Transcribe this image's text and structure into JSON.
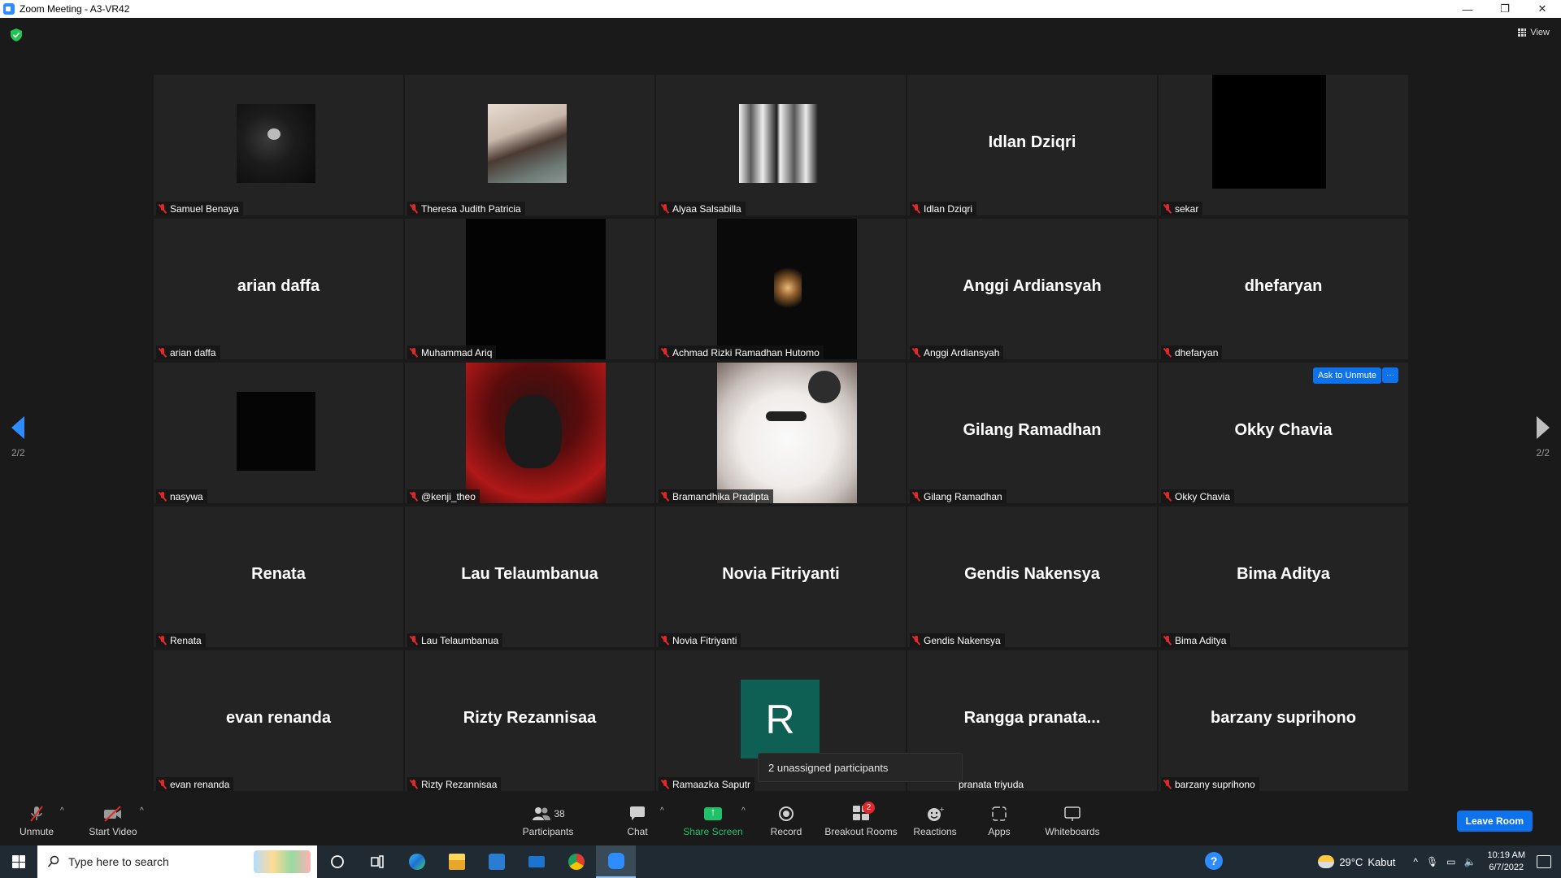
{
  "window": {
    "title": "Zoom Meeting - A3-VR42",
    "controls": [
      "—",
      "❐",
      "✕"
    ]
  },
  "top": {
    "view_label": "View"
  },
  "pagination": {
    "left": "2/2",
    "right": "2/2"
  },
  "tiles": [
    {
      "name": "Samuel Benaya",
      "big": "",
      "photo": "dark"
    },
    {
      "name": "Theresa Judith Patricia",
      "big": "",
      "photo": "girl"
    },
    {
      "name": "Alyaa Salsabilla",
      "big": "",
      "photo": "twins"
    },
    {
      "name": "Idlan Dziqri",
      "big": "Idlan Dziqri",
      "photo": ""
    },
    {
      "name": "sekar",
      "big": "",
      "photo": "blackrect"
    },
    {
      "name": "arian daffa",
      "big": "arian daffa",
      "photo": ""
    },
    {
      "name": "Muhammad Ariq",
      "big": "",
      "photo": "tallblack"
    },
    {
      "name": "Achmad Rizki Ramadhan Hutomo",
      "big": "",
      "photo": "candles"
    },
    {
      "name": "Anggi Ardiansyah",
      "big": "Anggi Ardiansyah",
      "photo": ""
    },
    {
      "name": "dhefaryan",
      "big": "dhefaryan",
      "photo": ""
    },
    {
      "name": "nasywa",
      "big": "",
      "photo": "nasywa"
    },
    {
      "name": "@kenji_theo",
      "big": "",
      "photo": "red"
    },
    {
      "name": "Bramandhika Pradipta",
      "big": "",
      "photo": "cat"
    },
    {
      "name": "Gilang Ramadhan",
      "big": "Gilang Ramadhan",
      "photo": ""
    },
    {
      "name": "Okky Chavia",
      "big": "Okky Chavia",
      "photo": ""
    },
    {
      "name": "Renata",
      "big": "Renata",
      "photo": ""
    },
    {
      "name": "Lau Telaumbanua",
      "big": "Lau Telaumbanua",
      "photo": ""
    },
    {
      "name": "Novia Fitriyanti",
      "big": "Novia Fitriyanti",
      "photo": ""
    },
    {
      "name": "Gendis Nakensya",
      "big": "Gendis Nakensya",
      "photo": ""
    },
    {
      "name": "Bima Aditya",
      "big": "Bima Aditya",
      "photo": ""
    },
    {
      "name": "evan renanda",
      "big": "evan renanda",
      "photo": ""
    },
    {
      "name": "Rizty Rezannisaa",
      "big": "Rizty Rezannisaa",
      "photo": ""
    },
    {
      "name": "Ramaazka Saputr",
      "big": "",
      "photo": "avatar"
    },
    {
      "name": "pranata triyuda",
      "big": "Rangga  pranata...",
      "photo": ""
    },
    {
      "name": "barzany suprihono",
      "big": "barzany suprihono",
      "photo": ""
    }
  ],
  "avatar_letter": "R",
  "okky_actions": {
    "ask_to_unmute": "Ask to Unmute",
    "more": "···"
  },
  "tooltip": "2 unassigned participants",
  "toolbar": {
    "unmute": "Unmute",
    "start_video": "Start Video",
    "participants": "Participants",
    "participants_count": "38",
    "chat": "Chat",
    "share_screen": "Share Screen",
    "record": "Record",
    "breakout_rooms": "Breakout Rooms",
    "breakout_badge": "2",
    "reactions": "Reactions",
    "apps": "Apps",
    "whiteboards": "Whiteboards",
    "leave_room": "Leave Room"
  },
  "taskbar": {
    "search_placeholder": "Type here to search",
    "weather_temp": "29°C",
    "weather_desc": "Kabut",
    "time": "10:19 AM",
    "date": "6/7/2022"
  },
  "colors": {
    "zoom_blue": "#0e72ed",
    "muted_red": "#e02828",
    "share_green": "#1fc16b",
    "tile_bg": "#232323",
    "avatar_green": "#0e5f54"
  }
}
